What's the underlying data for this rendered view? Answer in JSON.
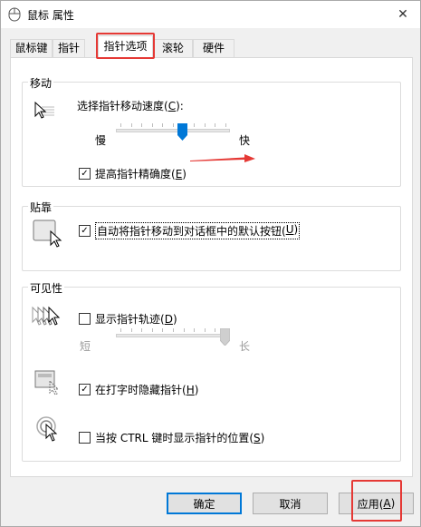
{
  "window": {
    "title": "鼠标 属性",
    "close_symbol": "✕"
  },
  "tabs": [
    {
      "label": "鼠标键"
    },
    {
      "label": "指针"
    },
    {
      "label": "指针选项",
      "active": true
    },
    {
      "label": "滚轮"
    },
    {
      "label": "硬件"
    }
  ],
  "motion": {
    "group_title": "移动",
    "speed_label_prefix": "选择指针移动速度(",
    "speed_label_key": "C",
    "speed_label_suffix": "):",
    "slow_label": "慢",
    "fast_label": "快",
    "speed_value_fraction": 0.59,
    "precision_checked": true,
    "precision_label_prefix": "提高指针精确度(",
    "precision_label_key": "E",
    "precision_label_suffix": ")"
  },
  "snap": {
    "group_title": "贴靠",
    "checked": true,
    "label_prefix": "自动将指针移动到对话框中的默认按钮(",
    "label_key": "U",
    "label_suffix": ")"
  },
  "visibility": {
    "group_title": "可见性",
    "trails_checked": false,
    "trails_label_prefix": "显示指针轨迹(",
    "trails_label_key": "D",
    "trails_label_suffix": ")",
    "short_label": "短",
    "long_label": "长",
    "trails_value_fraction": 1.0,
    "hide_typing_checked": true,
    "hide_typing_label_prefix": "在打字时隐藏指针(",
    "hide_typing_label_key": "H",
    "hide_typing_label_suffix": ")",
    "ctrl_checked": false,
    "ctrl_label_prefix": "当按 CTRL 键时显示指针的位置(",
    "ctrl_label_key": "S",
    "ctrl_label_suffix": ")"
  },
  "buttons": {
    "ok": "确定",
    "cancel": "取消",
    "apply_prefix": "应用(",
    "apply_key": "A",
    "apply_suffix": ")"
  },
  "colors": {
    "highlight_red": "#e53935",
    "accent_blue": "#0078d7",
    "arrow_red": "#e53935"
  }
}
